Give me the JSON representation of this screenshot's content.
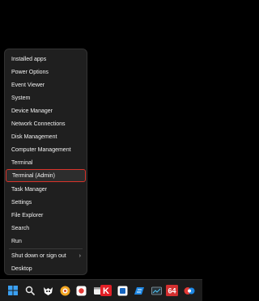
{
  "context_menu": {
    "items": [
      {
        "label": "Installed apps"
      },
      {
        "label": "Power Options"
      },
      {
        "label": "Event Viewer"
      },
      {
        "label": "System"
      },
      {
        "label": "Device Manager"
      },
      {
        "label": "Network Connections"
      },
      {
        "label": "Disk Management"
      },
      {
        "label": "Computer Management"
      },
      {
        "label": "Terminal"
      },
      {
        "label": "Terminal (Admin)"
      },
      {
        "label": "Task Manager"
      },
      {
        "label": "Settings"
      },
      {
        "label": "File Explorer"
      },
      {
        "label": "Search"
      },
      {
        "label": "Run"
      },
      {
        "label": "Shut down or sign out"
      },
      {
        "label": "Desktop"
      }
    ],
    "highlighted_item": "Terminal (Admin)",
    "submenu_chevron": "›"
  },
  "taskbar": {
    "icons": [
      "windows-start-icon",
      "search-icon",
      "app-icon-1",
      "app-icon-2",
      "app-icon-3",
      "app-icon-4",
      "k-app-icon",
      "app-icon-5",
      "app-icon-6",
      "app-icon-7",
      "64-app-icon",
      "app-icon-8"
    ],
    "labels": {
      "k_app": "K",
      "app_64": "64"
    }
  },
  "colors": {
    "menu_bg": "#1f1f1f",
    "highlight_border": "#d9342b",
    "background": "#000000"
  }
}
